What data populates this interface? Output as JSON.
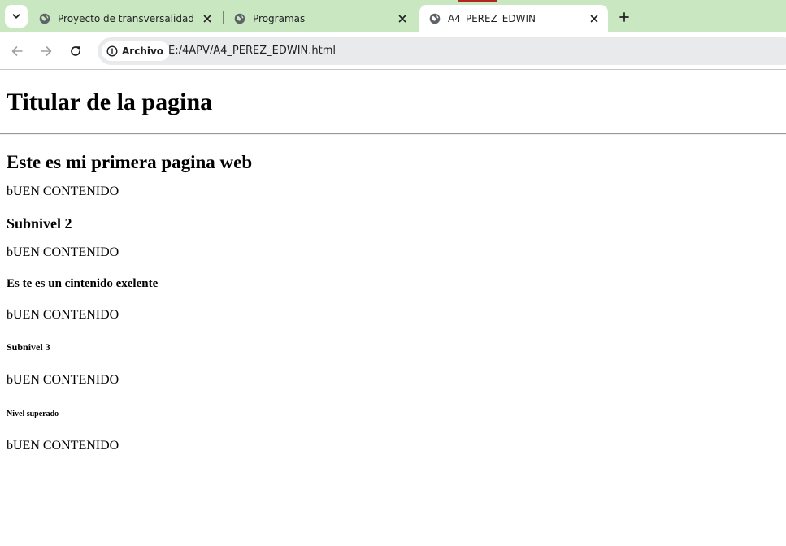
{
  "browser": {
    "tabs": [
      {
        "title": "Proyecto de transversalidad",
        "active": false
      },
      {
        "title": "Programas",
        "active": false
      },
      {
        "title": "A4_PEREZ_EDWIN",
        "active": true
      }
    ],
    "site_chip_label": "Archivo",
    "url": "E:/4APV/A4_PEREZ_EDWIN.html",
    "accent_color": "#c9e8c1",
    "icons": {
      "tab_search": "chevron-down-icon",
      "favicon": "globe-icon",
      "close": "close-icon",
      "new_tab": "plus-icon",
      "back": "arrow-left-icon",
      "forward": "arrow-right-icon",
      "reload": "reload-icon",
      "info": "info-icon"
    }
  },
  "page": {
    "h1": "Titular de la pagina",
    "h2": "Este es mi primera pagina web",
    "p1": "bUEN CONTENIDO",
    "h3": "Subnivel 2",
    "p2": "bUEN CONTENIDO",
    "h4": "Es te es un cintenido exelente",
    "p3": "bUEN CONTENIDO",
    "h5": "Subnivel 3",
    "p4": "bUEN CONTENIDO",
    "h6": "Nivel superado",
    "p5": "bUEN CONTENIDO"
  }
}
